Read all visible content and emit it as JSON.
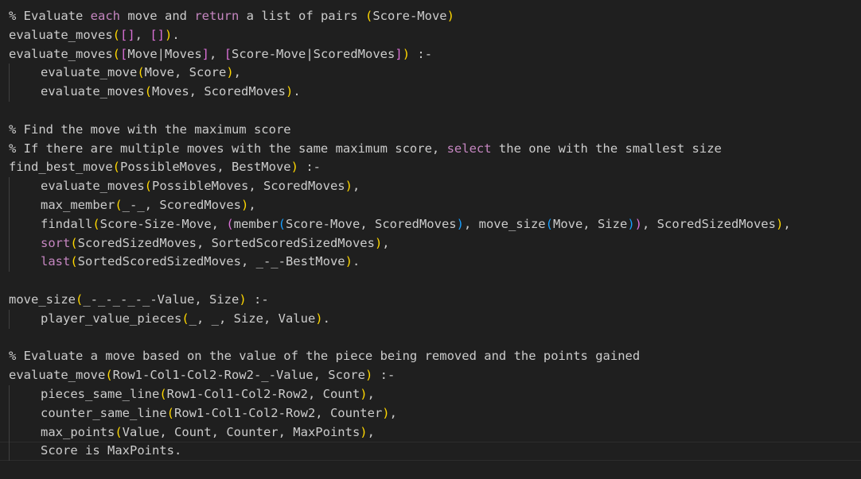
{
  "editor": {
    "lines": [
      {
        "indent": false,
        "tokens": [
          {
            "t": "% Evaluate ",
            "c": "default"
          },
          {
            "t": "each",
            "c": "kw"
          },
          {
            "t": " move ",
            "c": "default"
          },
          {
            "t": "and",
            "c": "default"
          },
          {
            "t": " ",
            "c": "default"
          },
          {
            "t": "return",
            "c": "kw"
          },
          {
            "t": " a list of pairs ",
            "c": "default"
          },
          {
            "t": "(",
            "c": "p1"
          },
          {
            "t": "Score-Move",
            "c": "default"
          },
          {
            "t": ")",
            "c": "p1"
          }
        ]
      },
      {
        "indent": false,
        "tokens": [
          {
            "t": "evaluate_moves",
            "c": "default"
          },
          {
            "t": "(",
            "c": "p1"
          },
          {
            "t": "[]",
            "c": "p2"
          },
          {
            "t": ", ",
            "c": "default"
          },
          {
            "t": "[]",
            "c": "p2"
          },
          {
            "t": ")",
            "c": "p1"
          },
          {
            "t": ".",
            "c": "default"
          }
        ]
      },
      {
        "indent": false,
        "tokens": [
          {
            "t": "evaluate_moves",
            "c": "default"
          },
          {
            "t": "(",
            "c": "p1"
          },
          {
            "t": "[",
            "c": "p2"
          },
          {
            "t": "Move|Moves",
            "c": "default"
          },
          {
            "t": "]",
            "c": "p2"
          },
          {
            "t": ", ",
            "c": "default"
          },
          {
            "t": "[",
            "c": "p2"
          },
          {
            "t": "Score-Move|ScoredMoves",
            "c": "default"
          },
          {
            "t": "]",
            "c": "p2"
          },
          {
            "t": ")",
            "c": "p1"
          },
          {
            "t": " :-",
            "c": "default"
          }
        ]
      },
      {
        "indent": true,
        "tokens": [
          {
            "t": "evaluate_move",
            "c": "default"
          },
          {
            "t": "(",
            "c": "p1"
          },
          {
            "t": "Move, Score",
            "c": "default"
          },
          {
            "t": ")",
            "c": "p1"
          },
          {
            "t": ",",
            "c": "default"
          }
        ]
      },
      {
        "indent": true,
        "tokens": [
          {
            "t": "evaluate_moves",
            "c": "default"
          },
          {
            "t": "(",
            "c": "p1"
          },
          {
            "t": "Moves, ScoredMoves",
            "c": "default"
          },
          {
            "t": ")",
            "c": "p1"
          },
          {
            "t": ".",
            "c": "default"
          }
        ]
      },
      {
        "indent": false,
        "tokens": [
          {
            "t": "",
            "c": "default"
          }
        ]
      },
      {
        "indent": false,
        "tokens": [
          {
            "t": "% Find the move with the maximum score",
            "c": "default"
          }
        ]
      },
      {
        "indent": false,
        "tokens": [
          {
            "t": "% If there are multiple moves with the same maximum score, ",
            "c": "default"
          },
          {
            "t": "select",
            "c": "kw"
          },
          {
            "t": " the one with the smallest size",
            "c": "default"
          }
        ]
      },
      {
        "indent": false,
        "tokens": [
          {
            "t": "find_best_move",
            "c": "default"
          },
          {
            "t": "(",
            "c": "p1"
          },
          {
            "t": "PossibleMoves, BestMove",
            "c": "default"
          },
          {
            "t": ")",
            "c": "p1"
          },
          {
            "t": " :-",
            "c": "default"
          }
        ]
      },
      {
        "indent": true,
        "tokens": [
          {
            "t": "evaluate_moves",
            "c": "default"
          },
          {
            "t": "(",
            "c": "p1"
          },
          {
            "t": "PossibleMoves, ScoredMoves",
            "c": "default"
          },
          {
            "t": ")",
            "c": "p1"
          },
          {
            "t": ",",
            "c": "default"
          }
        ]
      },
      {
        "indent": true,
        "tokens": [
          {
            "t": "max_member",
            "c": "default"
          },
          {
            "t": "(",
            "c": "p1"
          },
          {
            "t": "_-_, ScoredMoves",
            "c": "default"
          },
          {
            "t": ")",
            "c": "p1"
          },
          {
            "t": ",",
            "c": "default"
          }
        ]
      },
      {
        "indent": true,
        "tokens": [
          {
            "t": "findall",
            "c": "default"
          },
          {
            "t": "(",
            "c": "p1"
          },
          {
            "t": "Score-Size-Move, ",
            "c": "default"
          },
          {
            "t": "(",
            "c": "p2"
          },
          {
            "t": "member",
            "c": "default"
          },
          {
            "t": "(",
            "c": "p3"
          },
          {
            "t": "Score-Move, ScoredMoves",
            "c": "default"
          },
          {
            "t": ")",
            "c": "p3"
          },
          {
            "t": ", move_size",
            "c": "default"
          },
          {
            "t": "(",
            "c": "p3"
          },
          {
            "t": "Move, Size",
            "c": "default"
          },
          {
            "t": ")",
            "c": "p3"
          },
          {
            "t": ")",
            "c": "p2"
          },
          {
            "t": ", ScoredSizedMoves",
            "c": "default"
          },
          {
            "t": ")",
            "c": "p1"
          },
          {
            "t": ",",
            "c": "default"
          }
        ]
      },
      {
        "indent": true,
        "tokens": [
          {
            "t": "sort",
            "c": "kw"
          },
          {
            "t": "(",
            "c": "p1"
          },
          {
            "t": "ScoredSizedMoves, SortedScoredSizedMoves",
            "c": "default"
          },
          {
            "t": ")",
            "c": "p1"
          },
          {
            "t": ",",
            "c": "default"
          }
        ]
      },
      {
        "indent": true,
        "tokens": [
          {
            "t": "last",
            "c": "kw"
          },
          {
            "t": "(",
            "c": "p1"
          },
          {
            "t": "SortedScoredSizedMoves, _-_-BestMove",
            "c": "default"
          },
          {
            "t": ")",
            "c": "p1"
          },
          {
            "t": ".",
            "c": "default"
          }
        ]
      },
      {
        "indent": false,
        "tokens": [
          {
            "t": "",
            "c": "default"
          }
        ]
      },
      {
        "indent": false,
        "tokens": [
          {
            "t": "move_size",
            "c": "default"
          },
          {
            "t": "(",
            "c": "p1"
          },
          {
            "t": "_-_-_-_-_-Value, Size",
            "c": "default"
          },
          {
            "t": ")",
            "c": "p1"
          },
          {
            "t": " :-",
            "c": "default"
          }
        ]
      },
      {
        "indent": true,
        "tokens": [
          {
            "t": "player_value_pieces",
            "c": "default"
          },
          {
            "t": "(",
            "c": "p1"
          },
          {
            "t": "_, _, Size, Value",
            "c": "default"
          },
          {
            "t": ")",
            "c": "p1"
          },
          {
            "t": ".",
            "c": "default"
          }
        ]
      },
      {
        "indent": false,
        "tokens": [
          {
            "t": "",
            "c": "default"
          }
        ]
      },
      {
        "indent": false,
        "tokens": [
          {
            "t": "% Evaluate a move based on the value of the piece being removed ",
            "c": "default"
          },
          {
            "t": "and",
            "c": "default"
          },
          {
            "t": " the points gained",
            "c": "default"
          }
        ]
      },
      {
        "indent": false,
        "tokens": [
          {
            "t": "evaluate_move",
            "c": "default"
          },
          {
            "t": "(",
            "c": "p1"
          },
          {
            "t": "Row1-Col1-Col2-Row2-_-Value, Score",
            "c": "default"
          },
          {
            "t": ")",
            "c": "p1"
          },
          {
            "t": " :-",
            "c": "default"
          }
        ]
      },
      {
        "indent": true,
        "tokens": [
          {
            "t": "pieces_same_line",
            "c": "default"
          },
          {
            "t": "(",
            "c": "p1"
          },
          {
            "t": "Row1-Col1-Col2-Row2, Count",
            "c": "default"
          },
          {
            "t": ")",
            "c": "p1"
          },
          {
            "t": ",",
            "c": "default"
          }
        ]
      },
      {
        "indent": true,
        "tokens": [
          {
            "t": "counter_same_line",
            "c": "default"
          },
          {
            "t": "(",
            "c": "p1"
          },
          {
            "t": "Row1-Col1-Col2-Row2, Counter",
            "c": "default"
          },
          {
            "t": ")",
            "c": "p1"
          },
          {
            "t": ",",
            "c": "default"
          }
        ]
      },
      {
        "indent": true,
        "tokens": [
          {
            "t": "max_points",
            "c": "default"
          },
          {
            "t": "(",
            "c": "p1"
          },
          {
            "t": "Value, Count, Counter, MaxPoints",
            "c": "default"
          },
          {
            "t": ")",
            "c": "p1"
          },
          {
            "t": ",",
            "c": "default"
          }
        ]
      },
      {
        "indent": true,
        "current": true,
        "tokens": [
          {
            "t": "Score is MaxPoints.",
            "c": "default"
          }
        ]
      }
    ]
  }
}
